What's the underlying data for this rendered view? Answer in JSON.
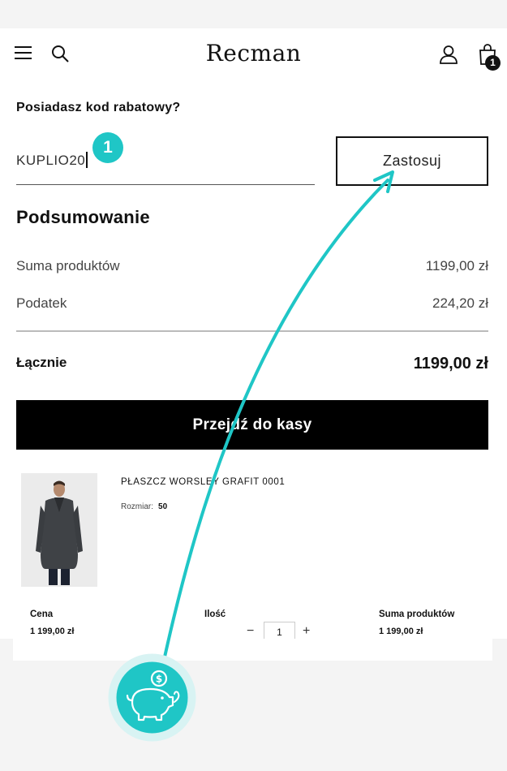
{
  "header": {
    "logo": "Recman",
    "cart_count": "1"
  },
  "coupon": {
    "question": "Posiadasz kod rabatowy?",
    "value": "KUPLIO20",
    "apply_label": "Zastosuj",
    "step_number": "1"
  },
  "summary": {
    "title": "Podsumowanie",
    "rows": [
      {
        "label": "Suma produktów",
        "value": "1199,00 zł"
      },
      {
        "label": "Podatek",
        "value": "224,20 zł"
      }
    ],
    "total_label": "Łącznie",
    "total_value": "1199,00 zł",
    "checkout_label": "Przejdź do kasy"
  },
  "product": {
    "name": "PŁASZCZ WORSLEY GRAFIT 0001",
    "size_label": "Rozmiar:",
    "size_value": "50",
    "price_header": "Cena",
    "price_value": "1 199,00 zł",
    "qty_header": "Ilość",
    "qty_value": "1",
    "qty_minus": "−",
    "qty_plus": "+",
    "sum_header": "Suma produktów",
    "sum_value": "1 199,00 zł"
  },
  "colors": {
    "accent": "#1fc6c6",
    "button_bg": "#000000"
  },
  "icons": [
    "menu-icon",
    "search-icon",
    "user-icon",
    "bag-icon",
    "piggy-bank-icon",
    "coin-icon"
  ]
}
